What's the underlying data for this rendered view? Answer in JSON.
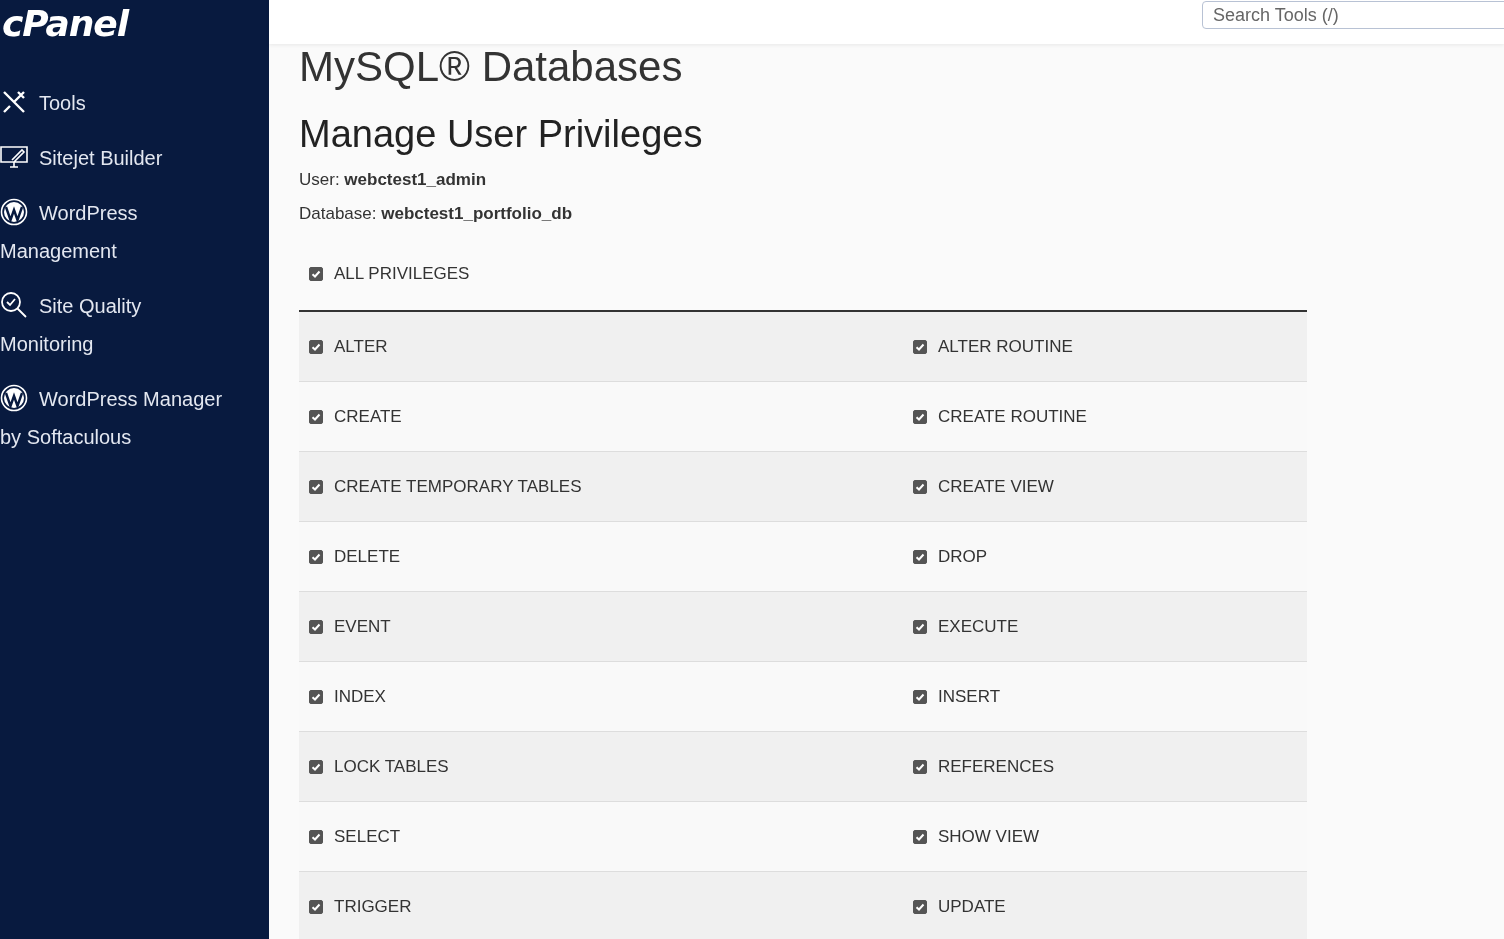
{
  "sidebar": {
    "logo": "cPanel",
    "items": [
      {
        "kind": "tools",
        "label": "Tools"
      },
      {
        "kind": "builder",
        "label": "Sitejet Builder"
      },
      {
        "kind": "wordpress",
        "label": "WordPress Management"
      },
      {
        "kind": "quality",
        "label": "Site Quality Monitoring"
      },
      {
        "kind": "wordpress",
        "label": "WordPress Manager by Softaculous"
      }
    ]
  },
  "header": {
    "search": {
      "placeholder": "Search Tools (/)"
    }
  },
  "page_title": "MySQL® Databases",
  "section_title": "Manage User Privileges",
  "details": [
    "User: **webctest1_admin**",
    "Database: **webctest1_portfolio_db**"
  ],
  "all_privileges": {
    "label": "ALL PRIVILEGES",
    "checked": true
  },
  "privileges": [
    [
      {
        "label": "ALTER",
        "checked": true
      },
      {
        "label": "ALTER ROUTINE",
        "checked": true
      }
    ],
    [
      {
        "label": "CREATE",
        "checked": true
      },
      {
        "label": "CREATE ROUTINE",
        "checked": true
      }
    ],
    [
      {
        "label": "CREATE TEMPORARY TABLES",
        "checked": true
      },
      {
        "label": "CREATE VIEW",
        "checked": true
      }
    ],
    [
      {
        "label": "DELETE",
        "checked": true
      },
      {
        "label": "DROP",
        "checked": true
      }
    ],
    [
      {
        "label": "EVENT",
        "checked": true
      },
      {
        "label": "EXECUTE",
        "checked": true
      }
    ],
    [
      {
        "label": "INDEX",
        "checked": true
      },
      {
        "label": "INSERT",
        "checked": true
      }
    ],
    [
      {
        "label": "LOCK TABLES",
        "checked": true
      },
      {
        "label": "REFERENCES",
        "checked": true
      }
    ],
    [
      {
        "label": "SELECT",
        "checked": true
      },
      {
        "label": "SHOW VIEW",
        "checked": true
      }
    ],
    [
      {
        "label": "TRIGGER",
        "checked": true
      },
      {
        "label": "UPDATE",
        "checked": true
      }
    ]
  ]
}
